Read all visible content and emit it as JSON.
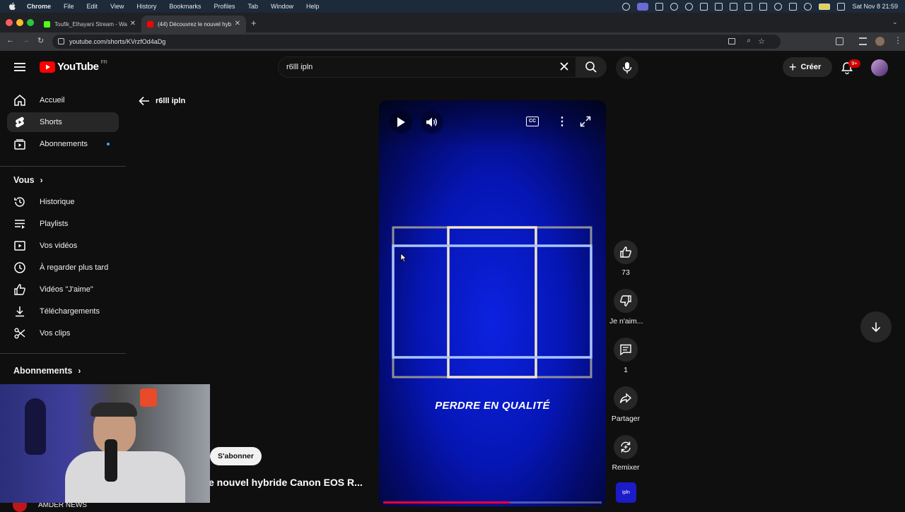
{
  "menubar": {
    "app": "Chrome",
    "items": [
      "File",
      "Edit",
      "View",
      "History",
      "Bookmarks",
      "Profiles",
      "Tab",
      "Window",
      "Help"
    ],
    "clock": "Sat Nov 8  21:59"
  },
  "tabs": [
    {
      "title": "Toufik_Elhayani Stream - Wa",
      "favicon_color": "#53fc18"
    },
    {
      "title": "(44) Découvrez le nouvel hyb",
      "favicon_color": "#ff0000"
    }
  ],
  "address": {
    "url": "youtube.com/shorts/KVrzfOd4aDg"
  },
  "youtube": {
    "logo_text": "YouTube",
    "region": "FR",
    "search_value": "r6lll ipln",
    "create_label": "Créer",
    "notif_badge": "9+",
    "sidebar": {
      "top": [
        {
          "label": "Accueil",
          "icon": "home-icon"
        },
        {
          "label": "Shorts",
          "icon": "shorts-icon"
        },
        {
          "label": "Abonnements",
          "icon": "subscriptions-icon"
        }
      ],
      "you_header": "Vous",
      "you_items": [
        {
          "label": "Historique",
          "icon": "history-icon"
        },
        {
          "label": "Playlists",
          "icon": "playlists-icon"
        },
        {
          "label": "Vos vidéos",
          "icon": "your-videos-icon"
        },
        {
          "label": "À regarder plus tard",
          "icon": "watch-later-icon"
        },
        {
          "label": "Vidéos \"J'aime\"",
          "icon": "liked-icon"
        },
        {
          "label": "Téléchargements",
          "icon": "downloads-icon"
        },
        {
          "label": "Vos clips",
          "icon": "clips-icon"
        }
      ],
      "subs_header": "Abonnements",
      "channel_partial": "AMDER NEWS"
    },
    "back_title": "r6lll ipln",
    "short": {
      "overlay_text": "PERDRE EN QUALITÉ",
      "subscribe_label": "S'abonner",
      "title_partial": "e nouvel hybride Canon EOS R...",
      "progress": 0.58
    },
    "actions": {
      "likes": "73",
      "dislike_label": "Je n'aim...",
      "comments": "1",
      "share_label": "Partager",
      "remix_label": "Remixer",
      "sound_label": "ipln"
    }
  }
}
